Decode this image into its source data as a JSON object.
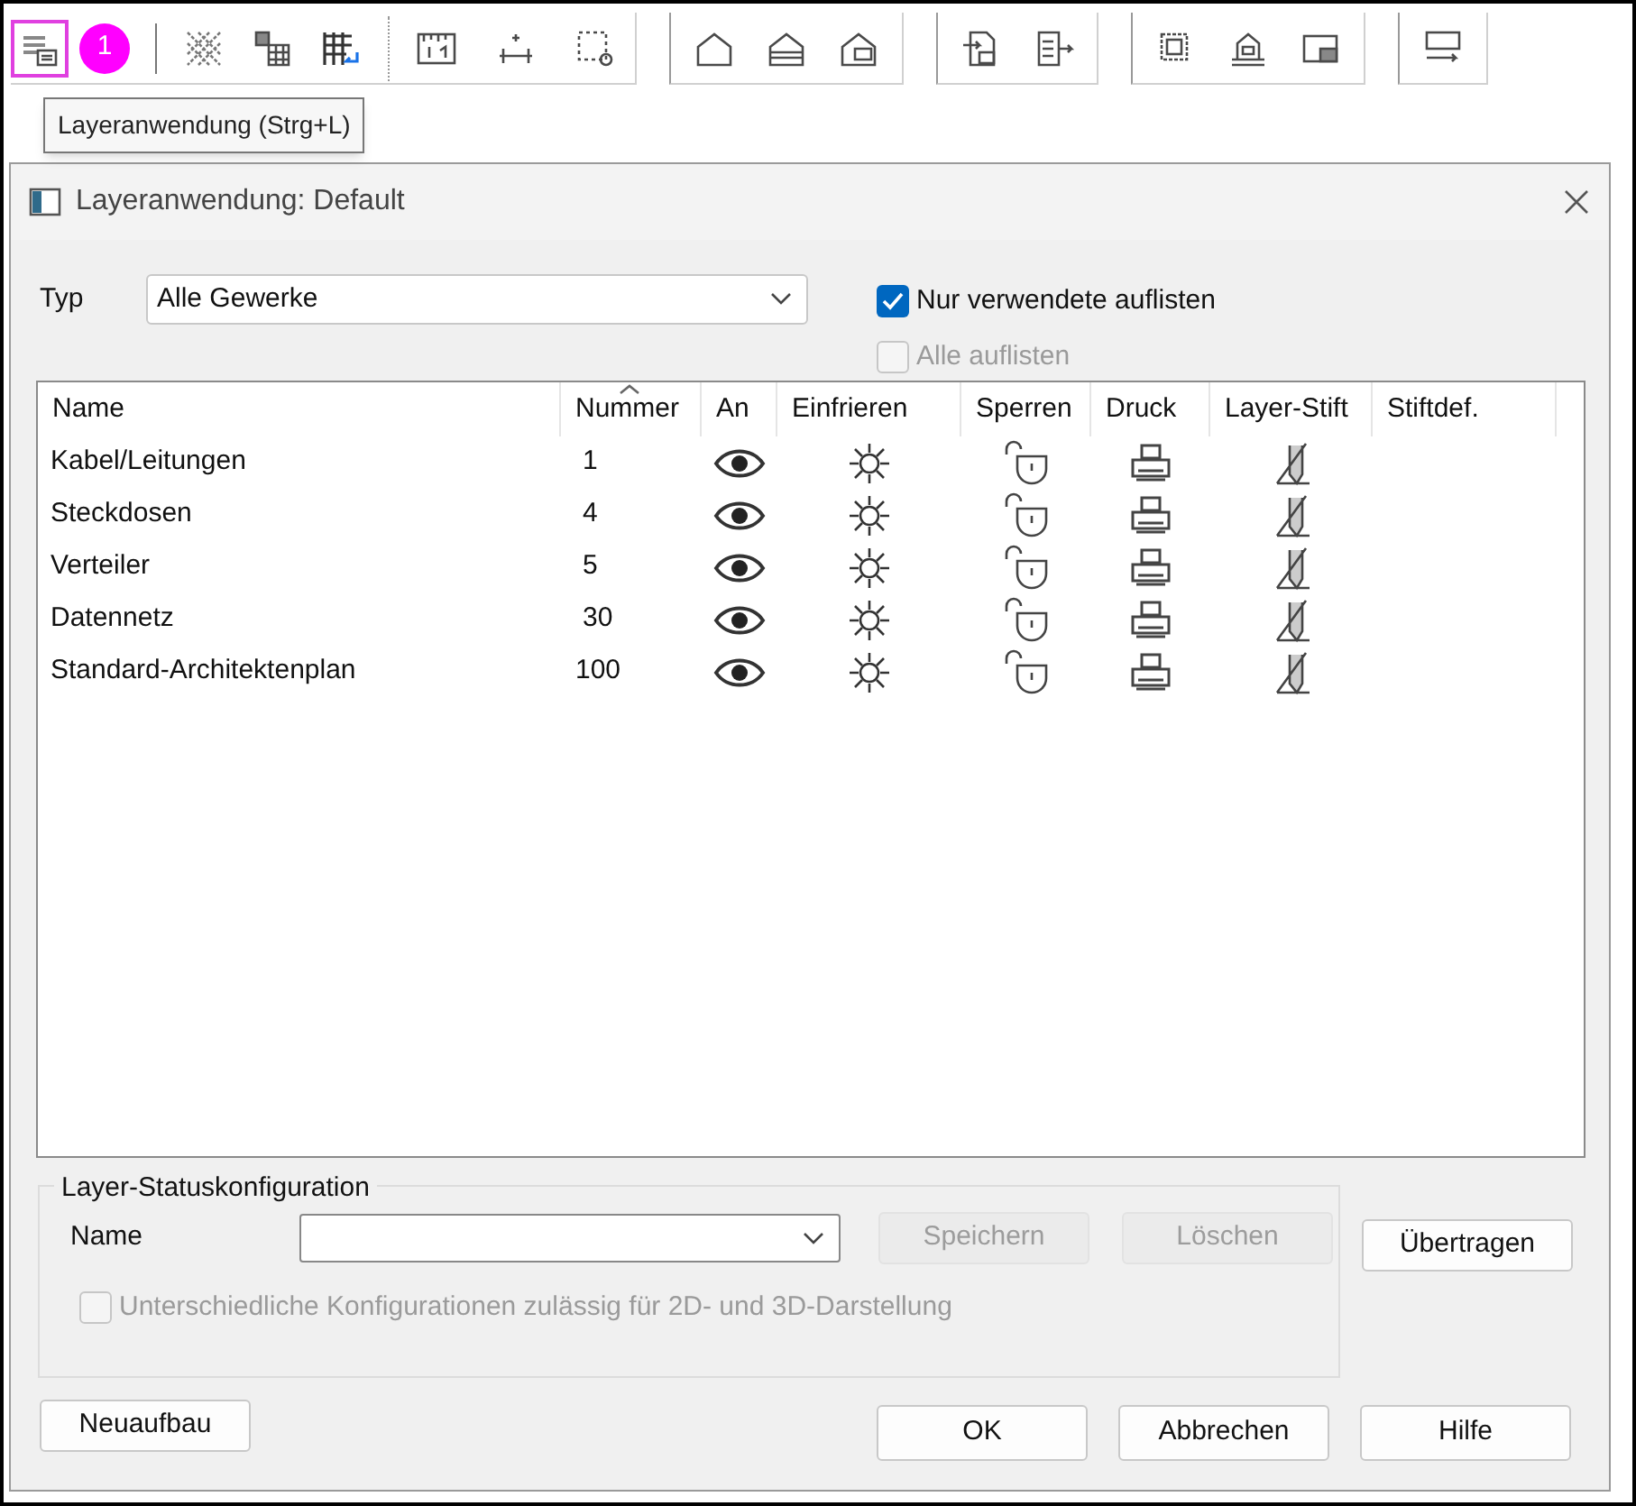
{
  "toolbar": {
    "badge": "1",
    "tooltip": "Layeranwendung (Strg+L)"
  },
  "dialog": {
    "title": "Layeranwendung: Default",
    "typ": {
      "label": "Typ",
      "value": "Alle Gewerke"
    },
    "options": [
      {
        "label": "Nur verwendete auflisten",
        "checked": true,
        "disabled": false
      },
      {
        "label": "Alle auflisten",
        "checked": false,
        "disabled": true
      }
    ],
    "table": {
      "columns": [
        {
          "label": "Name",
          "sorted": false
        },
        {
          "label": "Nummer",
          "sorted": true
        },
        {
          "label": "An",
          "sorted": false
        },
        {
          "label": "Einfrieren",
          "sorted": false
        },
        {
          "label": "Sperren",
          "sorted": false
        },
        {
          "label": "Druck",
          "sorted": false
        },
        {
          "label": "Layer-Stift",
          "sorted": false
        },
        {
          "label": "Stiftdef.",
          "sorted": false
        }
      ],
      "rows": [
        {
          "name": "Kabel/Leitungen",
          "number": "1"
        },
        {
          "name": "Steckdosen",
          "number": "4"
        },
        {
          "name": "Verteiler",
          "number": "5"
        },
        {
          "name": "Datennetz",
          "number": "30"
        },
        {
          "name": "Standard-Architektenplan",
          "number": "100"
        }
      ]
    },
    "config": {
      "title": "Layer-Statuskonfiguration",
      "name_label": "Name",
      "buttons": [
        {
          "label": "Speichern",
          "disabled": true
        },
        {
          "label": "Löschen",
          "disabled": true
        }
      ],
      "option": {
        "label": "Unterschiedliche Konfigurationen zulässig für 2D- und 3D-Darstellung",
        "checked": false,
        "disabled": true
      }
    },
    "transfer_button": "Übertragen",
    "rebuild_button": "Neuaufbau",
    "footer_buttons": [
      "OK",
      "Abbrechen",
      "Hilfe"
    ]
  }
}
